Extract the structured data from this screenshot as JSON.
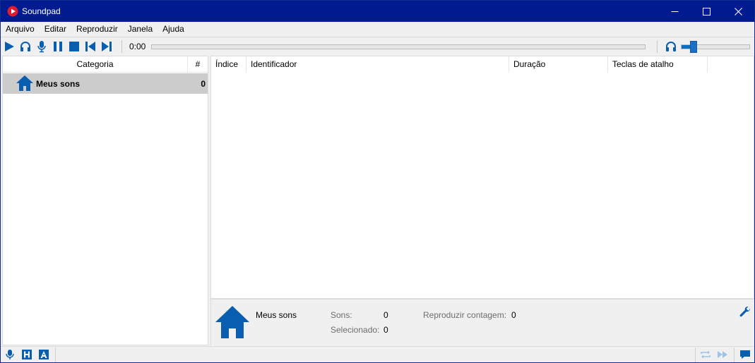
{
  "window": {
    "title": "Soundpad"
  },
  "menu": {
    "items": [
      {
        "label": "Arquivo"
      },
      {
        "label": "Editar"
      },
      {
        "label": "Reproduzir"
      },
      {
        "label": "Janela"
      },
      {
        "label": "Ajuda"
      }
    ]
  },
  "toolbar": {
    "time": "0:00",
    "volume_level": 0.18,
    "buttons": [
      "play-icon",
      "headphones-icon",
      "microphone-icon",
      "pause-icon",
      "stop-icon",
      "previous-icon",
      "next-icon"
    ]
  },
  "categories": {
    "header_category": "Categoria",
    "header_count": "#",
    "rows": [
      {
        "label": "Meus sons",
        "count": "0"
      }
    ]
  },
  "sound_list": {
    "columns": [
      "Índice",
      "Identificador",
      "Duração",
      "Teclas de atalho"
    ]
  },
  "info": {
    "name": "Meus sons",
    "sounds_label": "Sons:",
    "sounds_value": "0",
    "selected_label": "Selecionado:",
    "selected_value": "0",
    "play_count_label": "Reproduzir contagem:",
    "play_count_value": "0"
  },
  "statusbar": {
    "left_icons": [
      "microphone-icon",
      "h-icon",
      "a-icon"
    ],
    "right_icons": [
      "repeat-icon",
      "fast-forward-icon",
      "chat-icon"
    ]
  },
  "colors": {
    "titlebar": "#001b8f",
    "accent": "#0a5eb0",
    "selection": "#cccccc"
  }
}
